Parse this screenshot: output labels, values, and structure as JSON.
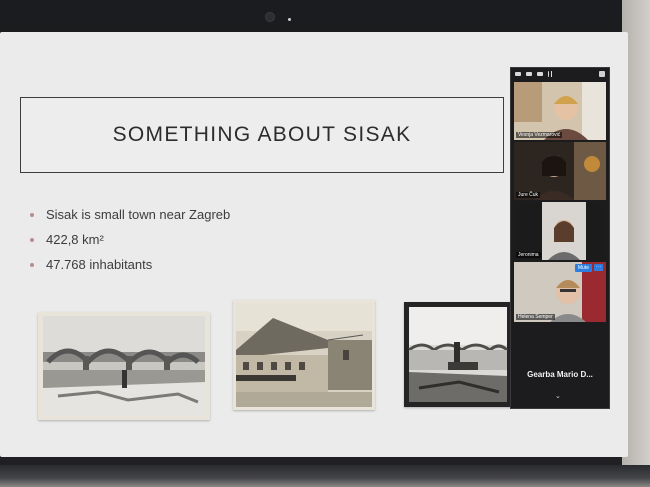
{
  "slide": {
    "title": "SOMETHING ABOUT SISAK",
    "bullets": [
      "Sisak is small town near Zagreb",
      "422,8 km²",
      "47.768 inhabitants"
    ]
  },
  "zoom": {
    "participants": [
      "Vesnja Vezmarović",
      "Jure Čuk",
      "Jeronima",
      "Helena Semper"
    ],
    "mute_label": "Mute",
    "more_label": "···",
    "active_speaker": "Gearba Mario D...",
    "chevron": "⌄"
  },
  "colors": {
    "slide_bg": "#ebebeb",
    "bullet_accent": "#b88d8d",
    "zoom_bg": "#1c1c1e",
    "zoom_blue": "#2d7de0"
  }
}
